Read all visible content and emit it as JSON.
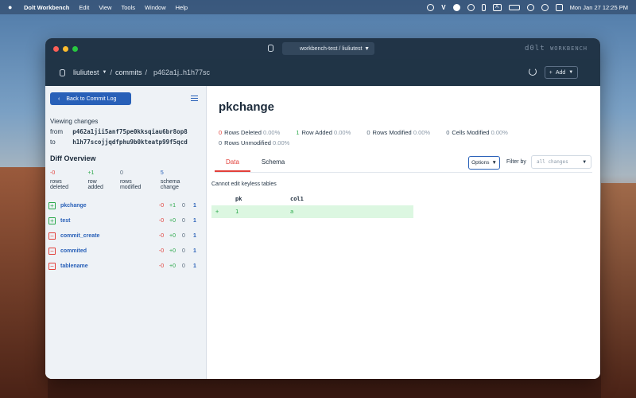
{
  "menubar": {
    "app_name": "Dolt Workbench",
    "menus": [
      "Edit",
      "View",
      "Tools",
      "Window",
      "Help"
    ],
    "status_icons": [
      "cloud-sync-icon",
      "vercel-icon",
      "waveform-icon",
      "moon-icon",
      "bluetooth-icon",
      "battery-icon",
      "wifi-icon",
      "spotlight-icon",
      "control-center-icon"
    ],
    "v_glyph": "V",
    "a_glyph": "A",
    "datetime": "Mon Jan 27  12:25 PM"
  },
  "window": {
    "connection": "workbench-test / liuliutest",
    "brand_main": "d0lt",
    "brand_sub": "WORKBENCH"
  },
  "breadcrumb": {
    "database": "liuliutest",
    "section": "commits",
    "commit_range": "p462a1j..h1h77sc"
  },
  "appbar": {
    "add_label": "Add"
  },
  "sidebar": {
    "back_label": "Back to Commit Log",
    "viewing_label": "Viewing changes",
    "from_label": "from",
    "from_hash": "p462a1jii5anf75pe0kksqiau6br8op8",
    "to_label": "to",
    "to_hash": "h1h77scojjqdfphu9b0kteatp99f5qcd",
    "diff_overview_title": "Diff Overview",
    "stats": [
      {
        "value": "-0",
        "label": "rows deleted",
        "tone": "red"
      },
      {
        "value": "+1",
        "label": "row added",
        "tone": "green"
      },
      {
        "value": "0",
        "label": "rows modified",
        "tone": "gray"
      },
      {
        "value": "5",
        "label": "schema change",
        "tone": "blue"
      }
    ],
    "tables": [
      {
        "name": "pkchange",
        "kind": "add",
        "deleted": "-0",
        "added": "+1",
        "modified": "0",
        "schema": "1"
      },
      {
        "name": "test",
        "kind": "add",
        "deleted": "-0",
        "added": "+0",
        "modified": "0",
        "schema": "1"
      },
      {
        "name": "commit_create",
        "kind": "del",
        "deleted": "-0",
        "added": "+0",
        "modified": "0",
        "schema": "1"
      },
      {
        "name": "commited",
        "kind": "del",
        "deleted": "-0",
        "added": "+0",
        "modified": "0",
        "schema": "1"
      },
      {
        "name": "tablename",
        "kind": "del",
        "deleted": "-0",
        "added": "+0",
        "modified": "0",
        "schema": "1"
      }
    ]
  },
  "main": {
    "title": "pkchange",
    "summary": [
      {
        "n": "0",
        "label": "Rows Deleted",
        "pct": "0.00%",
        "tone": "red"
      },
      {
        "n": "1",
        "label": "Row Added",
        "pct": "0.00%",
        "tone": "green"
      },
      {
        "n": "0",
        "label": "Rows Modified",
        "pct": "0.00%",
        "tone": "gray"
      },
      {
        "n": "0",
        "label": "Cells Modified",
        "pct": "0.00%",
        "tone": "gray"
      },
      {
        "n": "0",
        "label": "Rows Unmodified",
        "pct": "0.00%",
        "tone": "gray"
      }
    ],
    "tabs": [
      "Data",
      "Schema"
    ],
    "options_label": "Options",
    "filter_label": "Filter by",
    "filter_value": "all changes",
    "keyless_note": "Cannot edit keyless tables",
    "columns": [
      "pk",
      "col1"
    ],
    "rows": [
      {
        "marker": "+",
        "cells": [
          "1",
          "a"
        ]
      }
    ]
  },
  "colors": {
    "accent": "#2860b8",
    "added": "#2aa84a",
    "deleted": "#e2403a",
    "added_row_bg": "#dcf7e1",
    "header_bg": "#203446"
  }
}
